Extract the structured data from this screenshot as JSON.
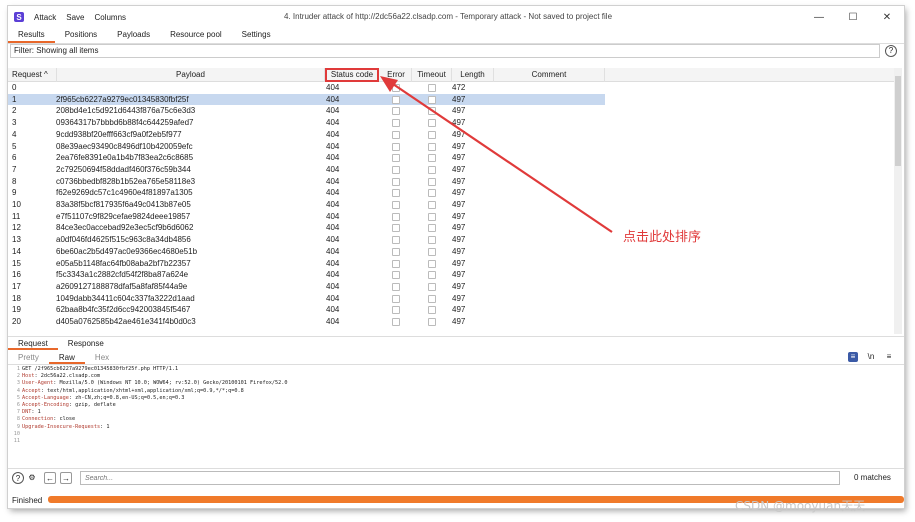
{
  "window": {
    "title": "4. Intruder attack of http://2dc56a22.clsadp.com - Temporary attack - Not saved to project file",
    "menu": [
      "Attack",
      "Save",
      "Columns"
    ],
    "app_icon": "burp-logo-icon",
    "controls": [
      "—",
      "☐",
      "✕"
    ]
  },
  "tabs": [
    "Results",
    "Positions",
    "Payloads",
    "Resource pool",
    "Settings"
  ],
  "filter": {
    "text": "Filter: Showing all items",
    "help": "?"
  },
  "table": {
    "headers": {
      "request": "Request ^",
      "payload": "Payload",
      "status": "Status code",
      "error": "Error",
      "timeout": "Timeout",
      "length": "Length",
      "comment": "Comment"
    },
    "rows": [
      {
        "request": "0",
        "payload": "",
        "status": "404",
        "length": "472",
        "selected": false
      },
      {
        "request": "1",
        "payload": "2f965cb6227a9279ec01345830fbf25f",
        "status": "404",
        "length": "497",
        "selected": true
      },
      {
        "request": "2",
        "payload": "208bd4e1c5d921d6443f876a75c6e3d3",
        "status": "404",
        "length": "497"
      },
      {
        "request": "3",
        "payload": "09364317b7bbbd6b88f4c644259afed7",
        "status": "404",
        "length": "497"
      },
      {
        "request": "4",
        "payload": "9cdd938bf20efff663cf9a0f2eb5f977",
        "status": "404",
        "length": "497"
      },
      {
        "request": "5",
        "payload": "08e39aec93490c8496df10b420059efc",
        "status": "404",
        "length": "497"
      },
      {
        "request": "6",
        "payload": "2ea76fe8391e0a1b4b7f83ea2c6c8685",
        "status": "404",
        "length": "497"
      },
      {
        "request": "7",
        "payload": "2c79250694f58ddadf460f376c59b344",
        "status": "404",
        "length": "497"
      },
      {
        "request": "8",
        "payload": "c0736bbedbf828b1b52ea765e58118e3",
        "status": "404",
        "length": "497"
      },
      {
        "request": "9",
        "payload": "f62e9269dc57c1c4960e4f81897a1305",
        "status": "404",
        "length": "497"
      },
      {
        "request": "10",
        "payload": "83a38f5bcf817935f6a49c0413b87e05",
        "status": "404",
        "length": "497"
      },
      {
        "request": "11",
        "payload": "e7f51107c9f829cefae9824deee19857",
        "status": "404",
        "length": "497"
      },
      {
        "request": "12",
        "payload": "84ce3ec0accebad92e3ec5cf9b6d6062",
        "status": "404",
        "length": "497"
      },
      {
        "request": "13",
        "payload": "a0df046fd4625f515c963c8a34db4856",
        "status": "404",
        "length": "497"
      },
      {
        "request": "14",
        "payload": "6be60ac2b5d497ac0e9366ec4680e51b",
        "status": "404",
        "length": "497"
      },
      {
        "request": "15",
        "payload": "e05a5b1148fac64fb08aba2bf7b22357",
        "status": "404",
        "length": "497"
      },
      {
        "request": "16",
        "payload": "f5c3343a1c2882cfd54f2f8ba87a624e",
        "status": "404",
        "length": "497"
      },
      {
        "request": "17",
        "payload": "a2609127188878dfaf5a8faf85f44a9e",
        "status": "404",
        "length": "497"
      },
      {
        "request": "18",
        "payload": "1049dabb34411c604c337fa3222d1aad",
        "status": "404",
        "length": "497"
      },
      {
        "request": "19",
        "payload": "62baa8b4fc35f2d6cc942003845f5467",
        "status": "404",
        "length": "497"
      },
      {
        "request": "20",
        "payload": "d405a0762585b42ae461e341f4b0d0c3",
        "status": "404",
        "length": "497"
      }
    ]
  },
  "request_pane": {
    "tabs": [
      "Request",
      "Response"
    ],
    "subtabs": [
      "Pretty",
      "Raw",
      "Hex"
    ],
    "icons": [
      "≡",
      "\\n",
      "≡"
    ],
    "lines": [
      {
        "n": "1",
        "key": "",
        "val": "GET /2f965cb6227a9279ec01345830fbf25f.php HTTP/1.1"
      },
      {
        "n": "2",
        "key": "Host",
        "val": ":  2dc56a22.clsadp.com"
      },
      {
        "n": "3",
        "key": "User-Agent",
        "val": ":  Mozilla/5.0 (Windows NT 10.0; WOW64; rv:52.0) Gecko/20100101 Firefox/52.0"
      },
      {
        "n": "4",
        "key": "Accept",
        "val": ":  text/html,application/xhtml+xml,application/xml;q=0.9,*/*;q=0.8"
      },
      {
        "n": "5",
        "key": "Accept-Language",
        "val": ":  zh-CN,zh;q=0.8,en-US;q=0.5,en;q=0.3"
      },
      {
        "n": "6",
        "key": "Accept-Encoding",
        "val": ":  gzip, deflate"
      },
      {
        "n": "7",
        "key": "DNT",
        "val": ":  1"
      },
      {
        "n": "8",
        "key": "Connection",
        "val": ":  close"
      },
      {
        "n": "9",
        "key": "Upgrade-Insecure-Requests",
        "val": ":  1"
      },
      {
        "n": "10",
        "key": "",
        "val": ""
      },
      {
        "n": "11",
        "key": "",
        "val": ""
      }
    ]
  },
  "search": {
    "placeholder": "Search...",
    "matches": "0 matches"
  },
  "status": {
    "text": "Finished"
  },
  "annotation": {
    "text": "点击此处排序",
    "color": "#e03a3a"
  },
  "watermark": "CSDN @mooyuan天天"
}
